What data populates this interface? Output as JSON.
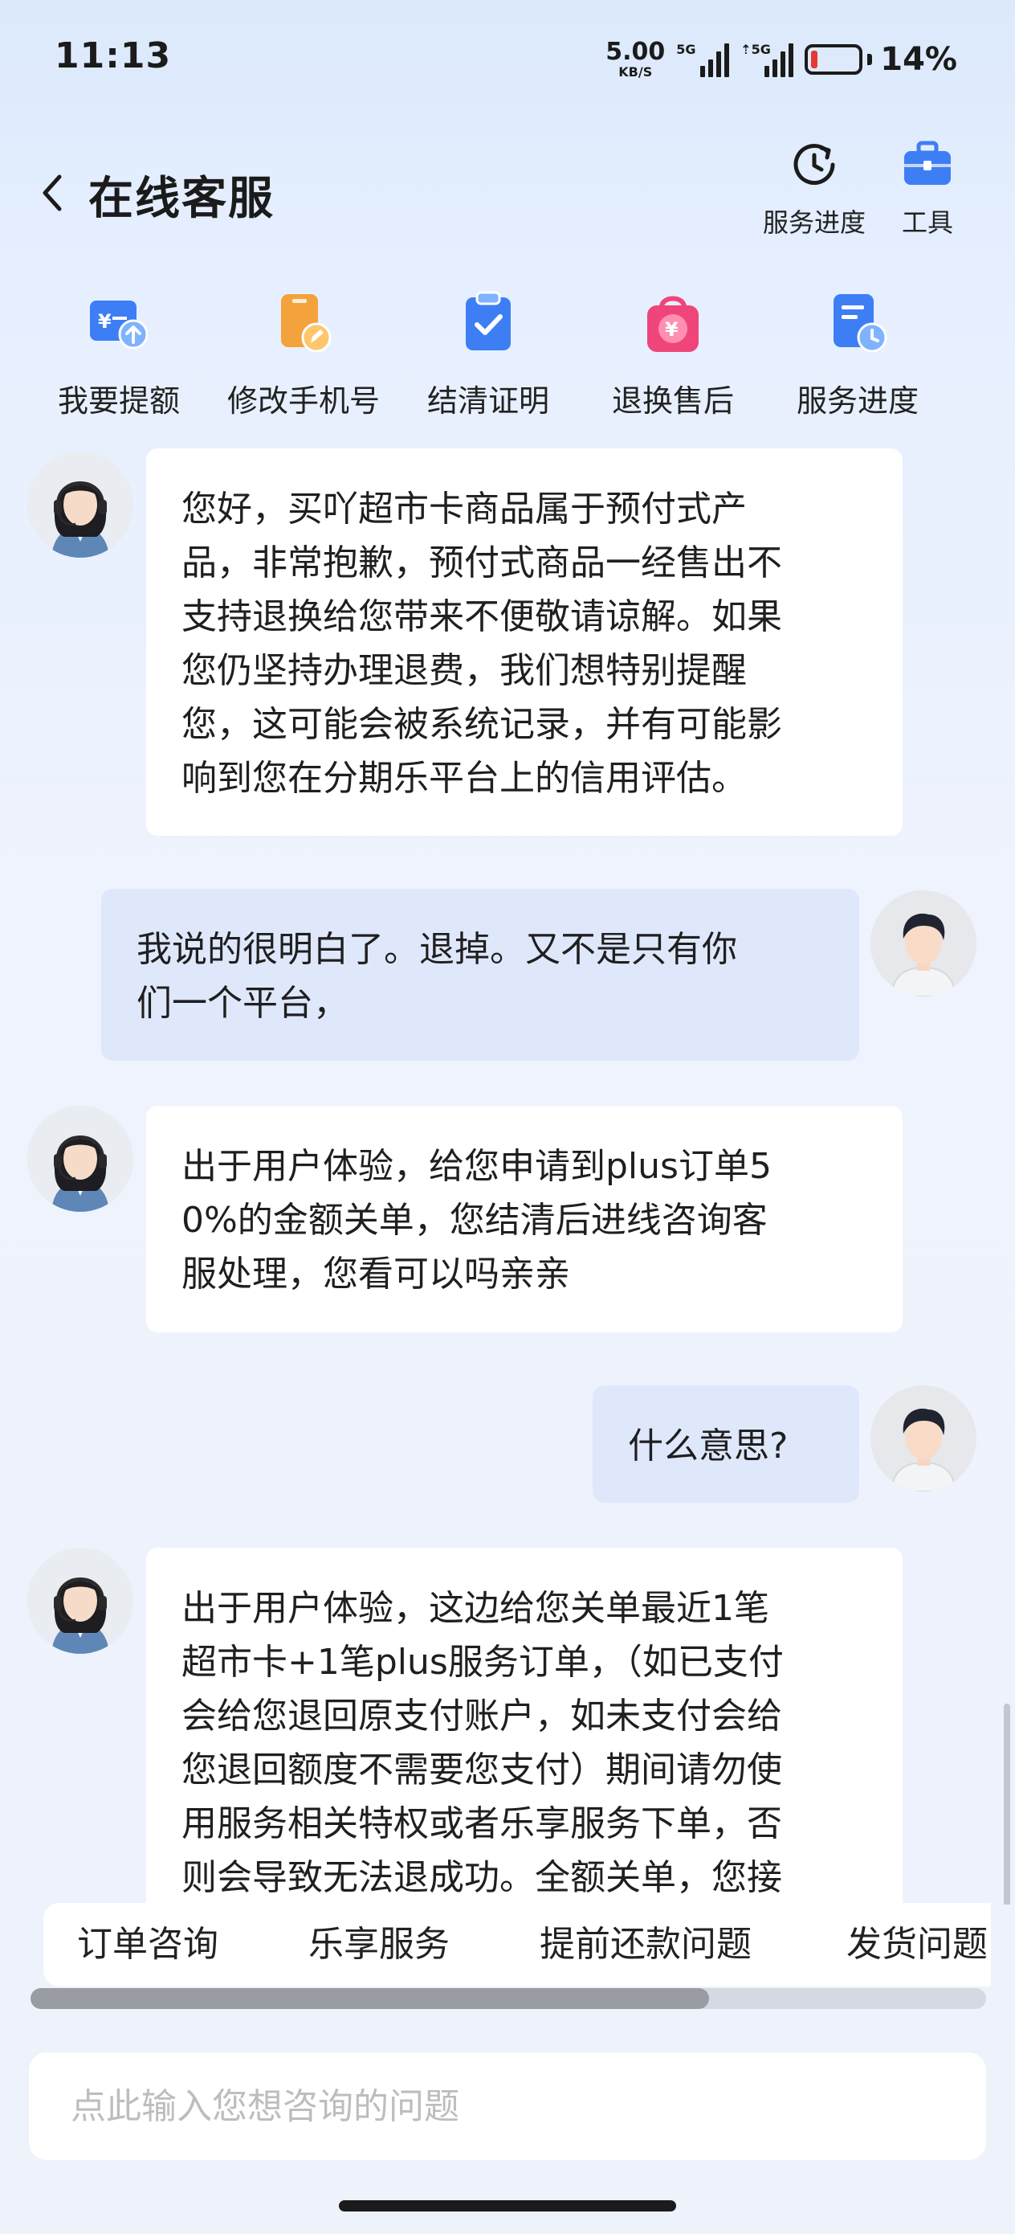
{
  "status_bar": {
    "time": "11:13",
    "net_speed": "5.00",
    "net_speed_unit": "KB/S",
    "sim1_tag": "5G",
    "sim2_tag": "⇡5G",
    "battery_percent": "14%",
    "battery_level": 0.14,
    "battery_color": "#e53935"
  },
  "header": {
    "title": "在线客服",
    "back_icon": "chevron-left-icon",
    "actions": [
      {
        "label": "服务进度",
        "icon": "clock-refresh-icon"
      },
      {
        "label": "工具",
        "icon": "toolbox-icon"
      }
    ]
  },
  "shortcuts": [
    {
      "label": "我要提额",
      "icon": "wallet-up-icon"
    },
    {
      "label": "修改手机号",
      "icon": "phone-edit-icon"
    },
    {
      "label": "结清证明",
      "icon": "clipboard-check-icon"
    },
    {
      "label": "退换售后",
      "icon": "bag-yen-icon"
    },
    {
      "label": "服务进度",
      "icon": "document-clock-icon"
    }
  ],
  "messages": [
    {
      "sender": "agent",
      "text": "您好，买吖超市卡商品属于预付式产\n品，非常抱歉，预付式商品一经售出不\n支持退换给您带来不便敬请谅解。如果\n您仍坚持办理退费，我们想特别提醒\n您，这可能会被系统记录，并有可能影\n响到您在分期乐平台上的信用评估。"
    },
    {
      "sender": "user",
      "text": "我说的很明白了。退掉。又不是只有你\n们一个平台，"
    },
    {
      "sender": "agent",
      "text": "出于用户体验，给您申请到plus订单5\n0%的金额关单，您结清后进线咨询客\n服处理，您看可以吗亲亲"
    },
    {
      "sender": "user",
      "text": "什么意思?"
    },
    {
      "sender": "agent",
      "text": "出于用户体验，这边给您关单最近1笔\n超市卡+1笔plus服务订单，（如已支付\n会给您退回原支付账户，如未支付会给\n您退回额度不需要您支付）期间请勿使\n用服务相关特权或者乐享服务下单，否\n则会导致无法退成功。全额关单，您接"
    }
  ],
  "quick_topics": [
    "订单咨询",
    "乐享服务",
    "提前还款问题",
    "发货问题"
  ],
  "quick_topics_scroll": 0.71,
  "input": {
    "placeholder": "点此输入您想咨询的问题",
    "value": ""
  },
  "colors": {
    "accent": "#3d7ef5",
    "orange": "#f4a23c",
    "pink": "#f0457a",
    "user_bubble": "#dfe8fb"
  }
}
